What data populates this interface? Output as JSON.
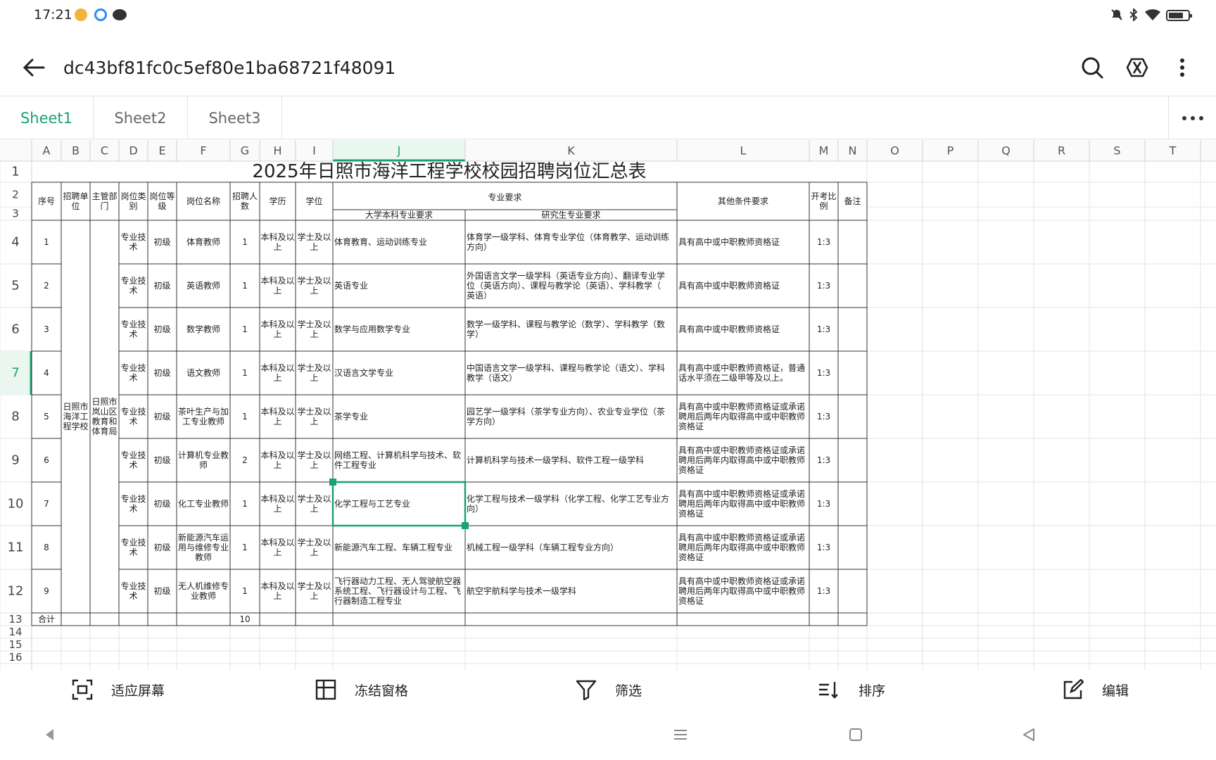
{
  "status_bar": {
    "time": "17:21"
  },
  "header": {
    "title": "dc43bf81fc0c5ef80e1ba68721f48091"
  },
  "sheet_tabs": [
    {
      "label": "Sheet1",
      "active": true
    },
    {
      "label": "Sheet2",
      "active": false
    },
    {
      "label": "Sheet3",
      "active": false
    }
  ],
  "columns": [
    "A",
    "B",
    "C",
    "D",
    "E",
    "F",
    "G",
    "H",
    "I",
    "J",
    "K",
    "L",
    "M",
    "N",
    "O",
    "P",
    "Q",
    "R",
    "S",
    "T"
  ],
  "row_numbers": [
    "1",
    "2",
    "3",
    "4",
    "5",
    "6",
    "7",
    "8",
    "9",
    "10",
    "11",
    "12",
    "13",
    "14",
    "15",
    "16"
  ],
  "selected_cell": "J7",
  "sheet": {
    "title": "2025年日照市海洋工程学校校园招聘岗位汇总表",
    "headers": {
      "no": "序号",
      "unit": "招聘单位",
      "dept": "主管部门",
      "category": "岗位类别",
      "level": "岗位等级",
      "post": "岗位名称",
      "count": "招聘人数",
      "edu": "学历",
      "degree": "学位",
      "major_group": "专业要求",
      "undergrad": "大学本科专业要求",
      "grad": "研究生专业要求",
      "other": "其他条件要求",
      "ratio": "开考比例",
      "note": "备注"
    },
    "merged_unit": "日照市海洋工程学校",
    "merged_dept": "日照市岚山区教育和体育局",
    "rows": [
      {
        "no": "1",
        "category": "专业技术",
        "level": "初级",
        "post": "体育教师",
        "count": "1",
        "edu": "本科及以上",
        "degree": "学士及以上",
        "undergrad": "体育教育、运动训练专业",
        "grad": "体育学一级学科、体育专业学位（体育教学、运动训练方向）",
        "other": "具有高中或中职教师资格证",
        "ratio": "1:3",
        "note": ""
      },
      {
        "no": "2",
        "category": "专业技术",
        "level": "初级",
        "post": "英语教师",
        "count": "1",
        "edu": "本科及以上",
        "degree": "学士及以上",
        "undergrad": "英语专业",
        "grad": "外国语言文学一级学科（英语专业方向）、翻译专业学位（英语方向）、课程与教学论（英语）、学科教学（英语）",
        "other": "具有高中或中职教师资格证",
        "ratio": "1:3",
        "note": ""
      },
      {
        "no": "3",
        "category": "专业技术",
        "level": "初级",
        "post": "数学教师",
        "count": "1",
        "edu": "本科及以上",
        "degree": "学士及以上",
        "undergrad": "数学与应用数学专业",
        "grad": "数学一级学科、课程与教学论（数学）、学科教学（数学）",
        "other": "具有高中或中职教师资格证",
        "ratio": "1:3",
        "note": ""
      },
      {
        "no": "4",
        "category": "专业技术",
        "level": "初级",
        "post": "语文教师",
        "count": "1",
        "edu": "本科及以上",
        "degree": "学士及以上",
        "undergrad": "汉语言文学专业",
        "grad": "中国语言文学一级学科、课程与教学论（语文）、学科教学（语文）",
        "other": "具有高中或中职教师资格证，普通话水平须在二级甲等及以上。",
        "ratio": "1:3",
        "note": ""
      },
      {
        "no": "5",
        "category": "专业技术",
        "level": "初级",
        "post": "茶叶生产与加工专业教师",
        "count": "1",
        "edu": "本科及以上",
        "degree": "学士及以上",
        "undergrad": "茶学专业",
        "grad": "园艺学一级学科（茶学专业方向）、农业专业学位（茶学方向）",
        "other": "具有高中或中职教师资格证或承诺聘用后两年内取得高中或中职教师资格证",
        "ratio": "1:3",
        "note": ""
      },
      {
        "no": "6",
        "category": "专业技术",
        "level": "初级",
        "post": "计算机专业教师",
        "count": "2",
        "edu": "本科及以上",
        "degree": "学士及以上",
        "undergrad": "网络工程、计算机科学与技术、软件工程专业",
        "grad": "计算机科学与技术一级学科、软件工程一级学科",
        "other": "具有高中或中职教师资格证或承诺聘用后两年内取得高中或中职教师资格证",
        "ratio": "1:3",
        "note": ""
      },
      {
        "no": "7",
        "category": "专业技术",
        "level": "初级",
        "post": "化工专业教师",
        "count": "1",
        "edu": "本科及以上",
        "degree": "学士及以上",
        "undergrad": "化学工程与工艺专业",
        "grad": "化学工程与技术一级学科（化学工程、化学工艺专业方向）",
        "other": "具有高中或中职教师资格证或承诺聘用后两年内取得高中或中职教师资格证",
        "ratio": "1:3",
        "note": ""
      },
      {
        "no": "8",
        "category": "专业技术",
        "level": "初级",
        "post": "新能源汽车运用与维修专业教师",
        "count": "1",
        "edu": "本科及以上",
        "degree": "学士及以上",
        "undergrad": "新能源汽车工程、车辆工程专业",
        "grad": "机械工程一级学科（车辆工程专业方向）",
        "other": "具有高中或中职教师资格证或承诺聘用后两年内取得高中或中职教师资格证",
        "ratio": "1:3",
        "note": ""
      },
      {
        "no": "9",
        "category": "专业技术",
        "level": "初级",
        "post": "无人机维修专业教师",
        "count": "1",
        "edu": "本科及以上",
        "degree": "学士及以上",
        "undergrad": "飞行器动力工程、无人驾驶航空器系统工程、飞行器设计与工程、飞行器制造工程专业",
        "grad": "航空宇航科学与技术一级学科",
        "other": "具有高中或中职教师资格证或承诺聘用后两年内取得高中或中职教师资格证",
        "ratio": "1:3",
        "note": ""
      }
    ],
    "total": {
      "label": "合计",
      "count": "10"
    }
  },
  "toolbar": {
    "fit": "适应屏幕",
    "freeze": "冻结窗格",
    "filter": "筛选",
    "sort": "排序",
    "edit": "编辑"
  },
  "colors": {
    "accent": "#1aa26f",
    "grid": "#e3e3e3",
    "border": "#333333",
    "header_bg": "#ffffff"
  }
}
